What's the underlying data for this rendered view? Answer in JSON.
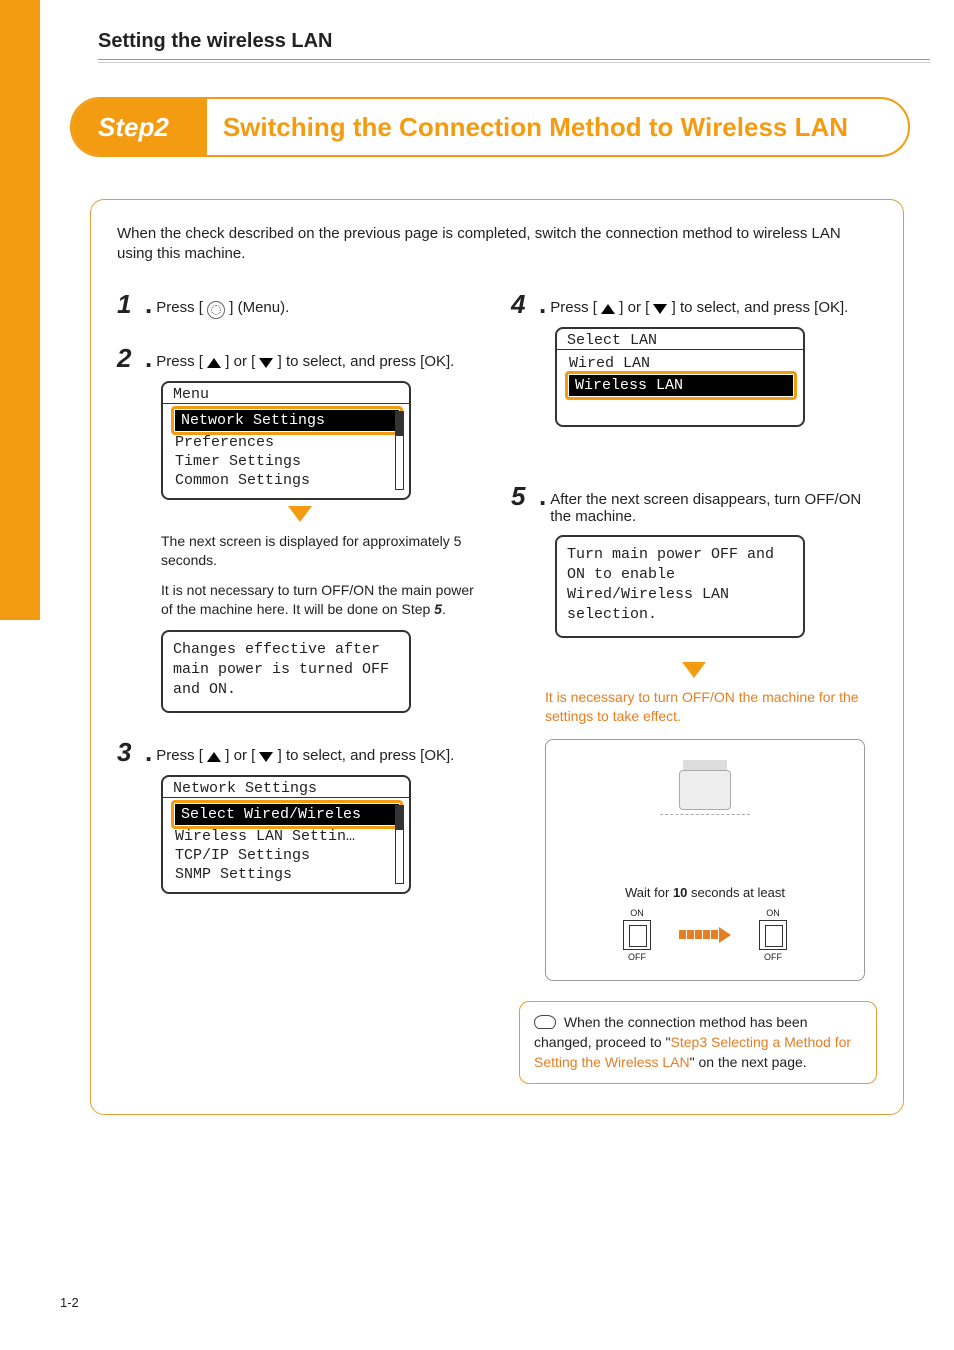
{
  "header": {
    "section": "Setting the wireless LAN"
  },
  "banner": {
    "step": "Step2",
    "title": "Switching the Connection Method to Wireless LAN"
  },
  "intro": "When the check described on the previous page is completed, switch the connection method to wireless LAN using this machine.",
  "s1": {
    "num": "1",
    "text_a": "Press [ ",
    "text_b": " ] (Menu)."
  },
  "s2": {
    "num": "2",
    "text_a": "Press [ ",
    "text_mid": " ] or [ ",
    "text_b": " ] to select, and press [OK].",
    "lcd_title": "Menu",
    "items": [
      "Network Settings",
      "Preferences",
      "Timer Settings",
      "Common Settings"
    ],
    "highlight_index": 0,
    "note1": "The next screen is displayed for approximately 5 seconds.",
    "note2_a": "It is not necessary to turn OFF/ON the main power of the machine here. It will be done on Step ",
    "note2_b": "5",
    "note2_c": ".",
    "message": "Changes effective after main power is turned OFF and ON."
  },
  "s3": {
    "num": "3",
    "text_a": "Press [ ",
    "text_mid": " ] or [ ",
    "text_b": " ] to select, and press [OK].",
    "lcd_title": "Network Settings",
    "items": [
      "Select Wired/Wireles",
      "Wireless LAN Settin…",
      "TCP/IP Settings",
      "SNMP Settings"
    ],
    "highlight_index": 0
  },
  "s4": {
    "num": "4",
    "text_a": "Press [ ",
    "text_mid": " ] or [ ",
    "text_b": " ] to select, and press [OK].",
    "lcd_title": "Select LAN",
    "items": [
      "Wired LAN",
      "Wireless LAN"
    ],
    "highlight_index": 1
  },
  "s5": {
    "num": "5",
    "text": "After the next screen disappears, turn OFF/ON the machine.",
    "message": "Turn main power OFF and ON to enable Wired/Wireless LAN selection.",
    "orange_note": "It is necessary to turn OFF/ON the machine for the settings to take effect.",
    "wait_a": "Wait for ",
    "wait_b": "10",
    "wait_c": " seconds at least",
    "on": "ON",
    "off": "OFF"
  },
  "footer": {
    "a": "When the connection method has been changed, proceed to \"",
    "link": "Step3 Selecting a Method for Setting the Wireless LAN",
    "b": "\" on the next page."
  },
  "page_num": "1-2"
}
